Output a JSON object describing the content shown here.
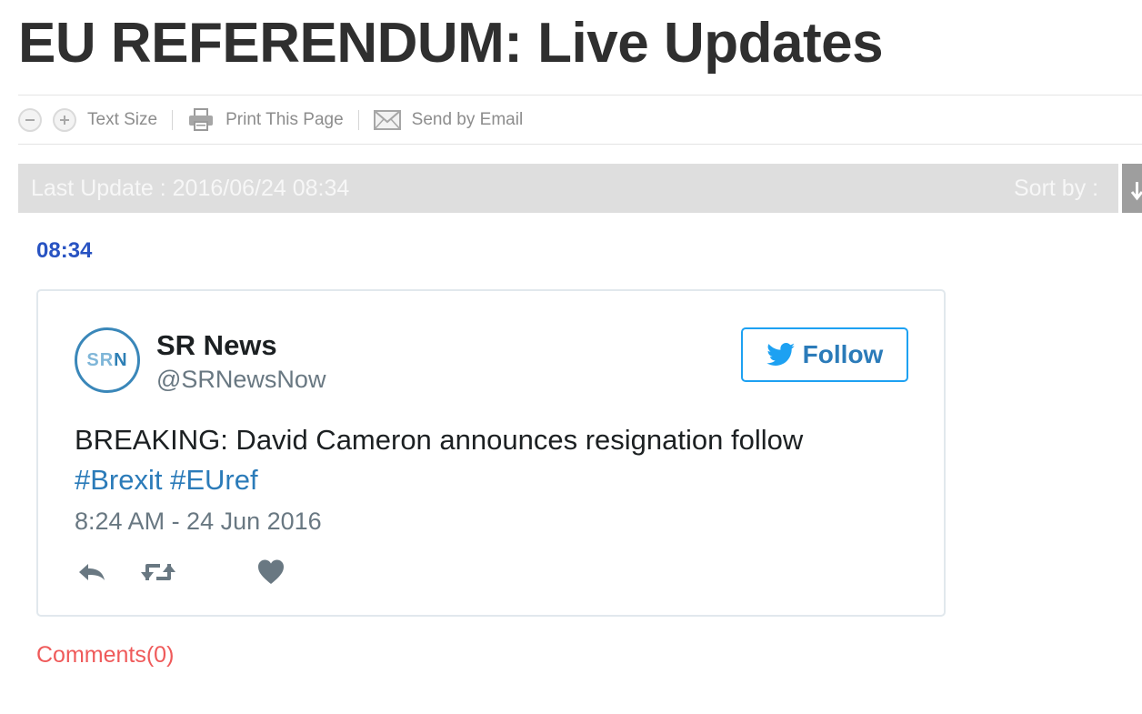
{
  "page": {
    "title": "EU REFERENDUM: Live Updates"
  },
  "toolbar": {
    "text_size_label": "Text Size",
    "print_label": "Print This Page",
    "email_label": "Send by Email"
  },
  "update_bar": {
    "last_update": "Last Update : 2016/06/24 08:34",
    "sort_label": "Sort by :"
  },
  "entry": {
    "time": "08:34",
    "comments_label": "Comments(0)"
  },
  "tweet": {
    "avatar_text_left": "SR",
    "avatar_text_right": "N",
    "author_name": "SR News",
    "author_handle": "@SRNewsNow",
    "follow_label": "Follow",
    "text": "BREAKING: David Cameron announces resignation follow",
    "hashtag_1": "#Brexit",
    "hashtag_2": "#EUref",
    "timestamp": "8:24 AM - 24 Jun 2016"
  },
  "colors": {
    "title": "#2f2f2f",
    "update_bar_bg": "#dedede",
    "entry_time": "#2853c2",
    "twitter_blue": "#1da1f2",
    "link_blue": "#2b7bb9",
    "comments": "#ef5a5a"
  },
  "icons": {
    "text_smaller": "minus-circle-icon",
    "text_larger": "plus-circle-icon",
    "print": "printer-icon",
    "email": "envelope-icon",
    "follow": "twitter-bird-icon",
    "reply": "reply-icon",
    "retweet": "retweet-icon",
    "like": "heart-icon",
    "sort": "sort-arrow-icon"
  }
}
